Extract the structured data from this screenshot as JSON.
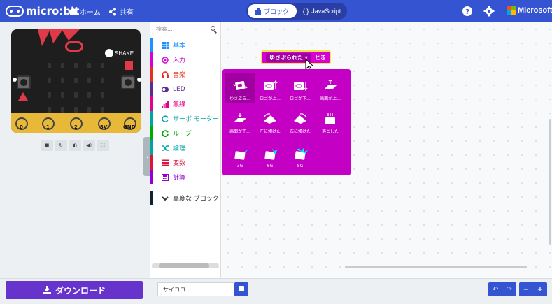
{
  "header": {
    "brand": "micro:bit",
    "home_label": "ホーム",
    "share_label": "共有",
    "toggle_blocks": "ブロック",
    "toggle_js": "JavaScript",
    "microsoft": "Microsoft",
    "bg_color": "#3454d1"
  },
  "simulator": {
    "shake_label": "SHAKE",
    "pins": [
      "0",
      "1",
      "2",
      "3V",
      "GND"
    ],
    "controls": [
      "stop-icon",
      "restart-icon",
      "sound-icon",
      "volume-icon",
      "fullscreen-icon"
    ]
  },
  "toolbox": {
    "search_placeholder": "検索...",
    "categories": [
      {
        "label": "基本",
        "color": "#1e90ff"
      },
      {
        "label": "入力",
        "color": "#d400d4"
      },
      {
        "label": "音楽",
        "color": "#e63022"
      },
      {
        "label": "LED",
        "color": "#5c2d91"
      },
      {
        "label": "無線",
        "color": "#e3008c"
      },
      {
        "label": "サーボ モーター",
        "color": "#00a4a6"
      },
      {
        "label": "ループ",
        "color": "#00aa00"
      },
      {
        "label": "論理",
        "color": "#00a4a6"
      },
      {
        "label": "変数",
        "color": "#dc143c"
      },
      {
        "label": "計算",
        "color": "#9400d3"
      },
      {
        "label": "高度な ブロック",
        "color": "#112233"
      }
    ]
  },
  "workspace": {
    "event_dropdown": "ゆさぶられた ▾",
    "event_suffix": "とき",
    "gestures": [
      {
        "label": "ゆさぶら..."
      },
      {
        "label": "ロゴが上..."
      },
      {
        "label": "ロゴが下..."
      },
      {
        "label": "画面が上..."
      },
      {
        "label": "画面が下..."
      },
      {
        "label": "左に傾けた"
      },
      {
        "label": "右に傾けた"
      },
      {
        "label": "落とした"
      },
      {
        "label": "3G"
      },
      {
        "label": "6G"
      },
      {
        "label": "8G"
      }
    ]
  },
  "footer": {
    "download_label": "ダウンロード",
    "project_name": "サイコロ"
  }
}
